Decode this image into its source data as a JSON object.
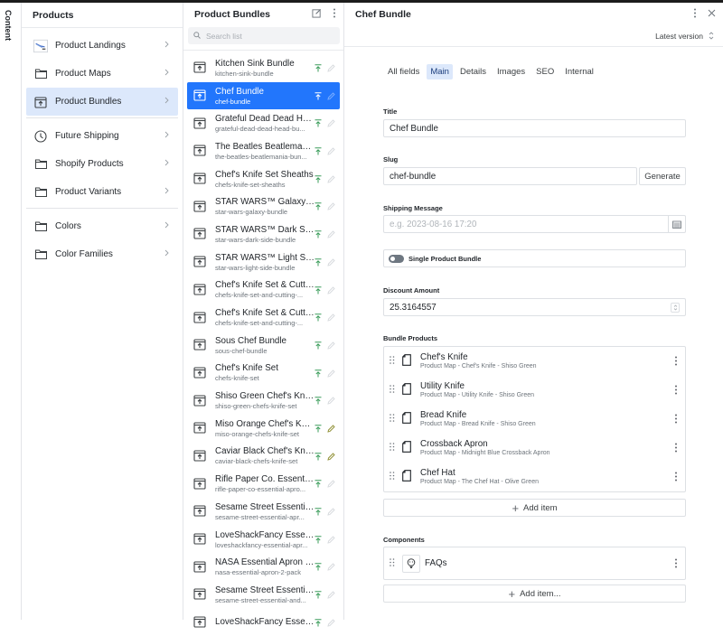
{
  "rail": {
    "label": "Content"
  },
  "structure": {
    "title": "Products",
    "items": [
      {
        "label": "Product Landings",
        "icon": "thumbnail-image"
      },
      {
        "label": "Product Maps",
        "icon": "folder-icon"
      },
      {
        "label": "Product Bundles",
        "icon": "publish-box-icon",
        "active": true
      },
      {
        "label": "Future Shipping",
        "icon": "clock-icon"
      },
      {
        "label": "Shopify Products",
        "icon": "folder-icon"
      },
      {
        "label": "Product Variants",
        "icon": "folder-icon"
      },
      {
        "label": "Colors",
        "icon": "folder-icon"
      },
      {
        "label": "Color Families",
        "icon": "folder-icon"
      }
    ]
  },
  "list": {
    "title": "Product Bundles",
    "search_placeholder": "Search list",
    "items": [
      {
        "title": "Kitchen Sink Bundle",
        "slug": "kitchen-sink-bundle"
      },
      {
        "title": "Chef Bundle",
        "slug": "chef-bundle",
        "active": true
      },
      {
        "title": "Grateful Dead Dead Hea...",
        "slug": "grateful-dead-dead-head-bu..."
      },
      {
        "title": "The Beatles Beatlemani...",
        "slug": "the-beatles-beatlemania-bun..."
      },
      {
        "title": "Chef's Knife Set Sheaths",
        "slug": "chefs-knife-set-sheaths"
      },
      {
        "title": "STAR WARS™ Galaxy B...",
        "slug": "star-wars-galaxy-bundle"
      },
      {
        "title": "STAR WARS™ Dark Side...",
        "slug": "star-wars-dark-side-bundle"
      },
      {
        "title": "STAR WARS™ Light Sid...",
        "slug": "star-wars-light-side-bundle"
      },
      {
        "title": "Chef's Knife Set & Cutti...",
        "slug": "chefs-knife-set-and-cutting-..."
      },
      {
        "title": "Chef's Knife Set & Cutti...",
        "slug": "chefs-knife-set-and-cutting-..."
      },
      {
        "title": "Sous Chef Bundle",
        "slug": "sous-chef-bundle"
      },
      {
        "title": "Chef's Knife Set",
        "slug": "chefs-knife-set"
      },
      {
        "title": "Shiso Green Chef's Knif...",
        "slug": "shiso-green-chefs-knife-set"
      },
      {
        "title": "Miso Orange Chef's Knif...",
        "slug": "miso-orange-chefs-knife-set",
        "draft": true
      },
      {
        "title": "Caviar Black Chef's Knif...",
        "slug": "caviar-black-chefs-knife-set",
        "draft": true
      },
      {
        "title": "Rifle Paper Co. Essential...",
        "slug": "rifle-paper-co-essential-apro..."
      },
      {
        "title": "Sesame Street Essential...",
        "slug": "sesame-street-essential-apr..."
      },
      {
        "title": "LoveShackFancy Essenti...",
        "slug": "loveshackfancy-essential-apr..."
      },
      {
        "title": "NASA Essential Apron 2...",
        "slug": "nasa-essential-apron-2-pack"
      },
      {
        "title": "Sesame Street Essential...",
        "slug": "sesame-street-essential-and..."
      },
      {
        "title": "LoveShackFancy Essenti...",
        "slug": ""
      }
    ]
  },
  "document": {
    "title": "Chef Bundle",
    "version_label": "Latest version",
    "tabs": [
      "All fields",
      "Main",
      "Details",
      "Images",
      "SEO",
      "Internal"
    ],
    "active_tab": "Main",
    "fields": {
      "title_label": "Title",
      "title_value": "Chef Bundle",
      "slug_label": "Slug",
      "slug_value": "chef-bundle",
      "generate_label": "Generate",
      "shipping_label": "Shipping Message",
      "shipping_placeholder": "e.g. 2023-08-16 17:20",
      "toggle_label": "Single Product Bundle",
      "toggle_on": false,
      "discount_label": "Discount Amount",
      "discount_value": "25.3164557",
      "bundle_label": "Bundle Products",
      "bundle_items": [
        {
          "title": "Chef's Knife",
          "subtitle": "Product Map - Chef's Knife - Shiso Green"
        },
        {
          "title": "Utility Knife",
          "subtitle": "Product Map - Utility Knife - Shiso Green"
        },
        {
          "title": "Bread Knife",
          "subtitle": "Product Map - Bread Knife - Shiso Green"
        },
        {
          "title": "Crossback Apron",
          "subtitle": "Product Map - Midnight Blue Crossback Apron"
        },
        {
          "title": "Chef Hat",
          "subtitle": "Product Map - The Chef Hat - Olive Green"
        }
      ],
      "add_item_label": "Add item",
      "components_label": "Components",
      "component_items": [
        {
          "title": "FAQs"
        }
      ],
      "add_component_label": "Add item..."
    }
  },
  "colors": {
    "accent": "#2276fc",
    "active_bg": "#dce8fb",
    "published_green": "#3a9c5a",
    "draft_olive": "#8a8a2a"
  }
}
